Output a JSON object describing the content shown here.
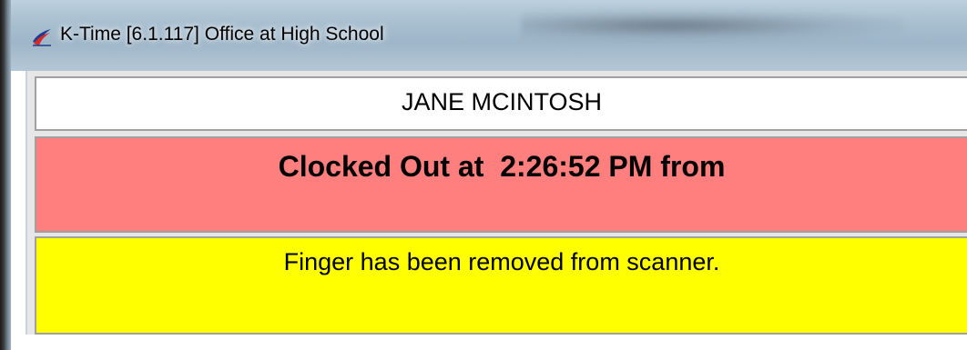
{
  "window": {
    "title": "K-Time [6.1.117] Office at High School",
    "icon": "k-time-app-icon"
  },
  "employee": {
    "name": "JANE MCINTOSH"
  },
  "status": {
    "text": "Clocked Out at  2:26:52 PM from",
    "color": "#ff7f7f"
  },
  "message": {
    "text": "Finger has been removed from scanner.",
    "color": "#ffff00"
  }
}
